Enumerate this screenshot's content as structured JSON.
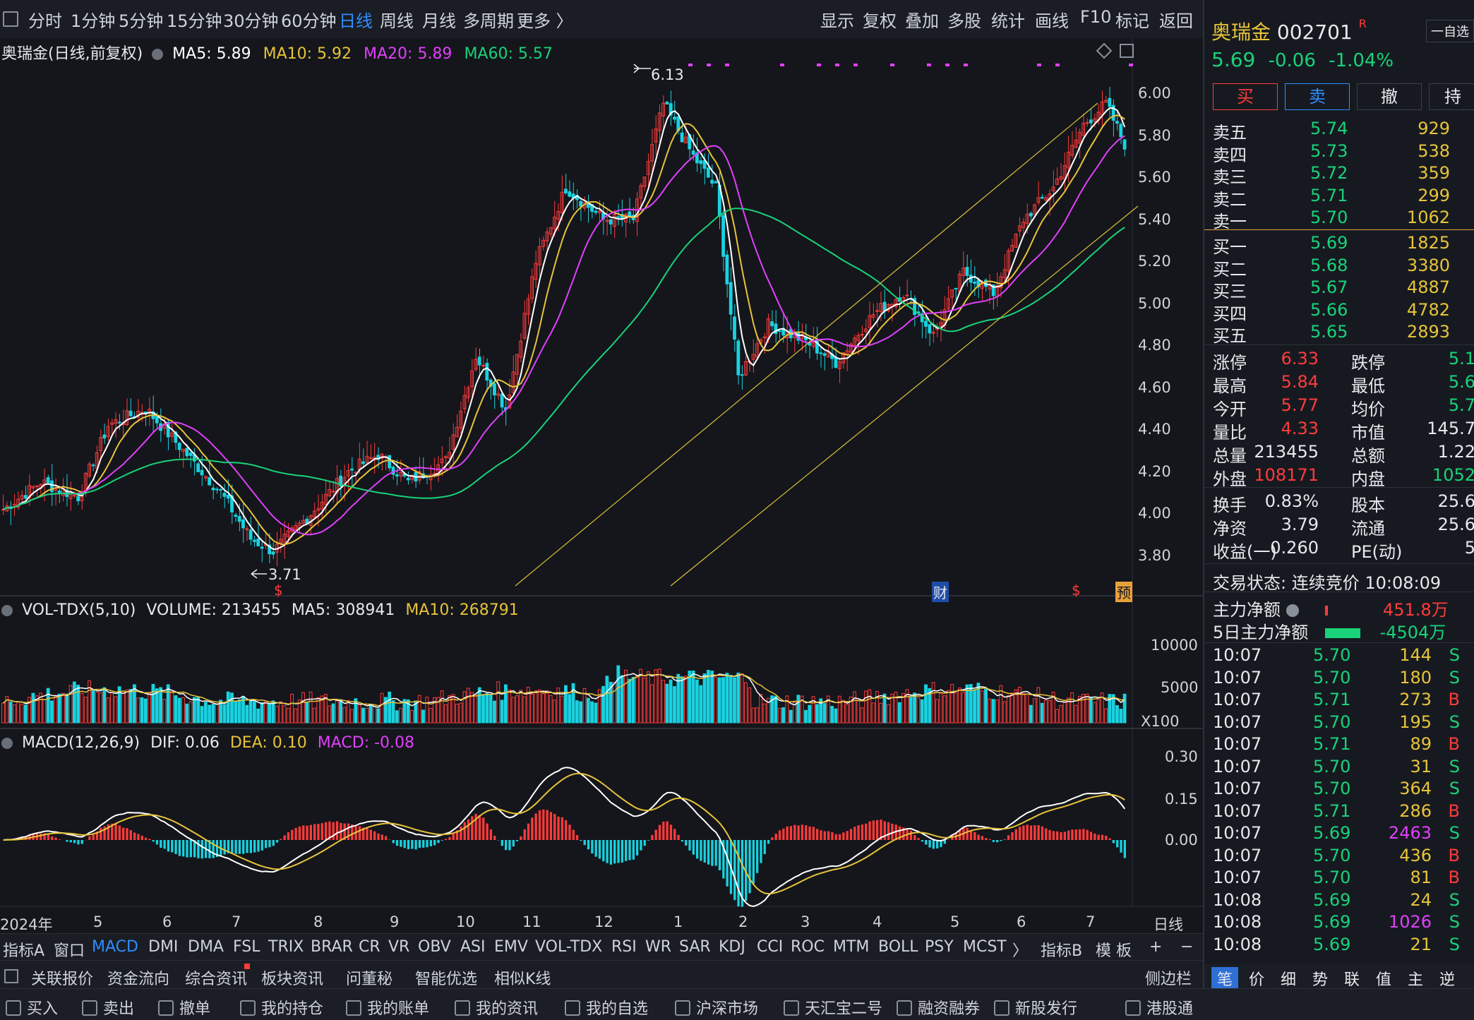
{
  "toolbar": {
    "periods": [
      "分时",
      "1分钟",
      "5分钟",
      "15分钟",
      "30分钟",
      "60分钟",
      "日线",
      "周线",
      "月线",
      "多周期",
      "更多 〉"
    ],
    "active_period": "日线",
    "right_tools": [
      "显示",
      "复权",
      "叠加",
      "多股",
      "统计",
      "画线",
      "F10",
      "标记",
      "返回"
    ]
  },
  "main": {
    "legend_title": "奥瑞金(日线,前复权)",
    "ma": [
      {
        "label": "MA5: 5.89",
        "color": "#ffffff"
      },
      {
        "label": "MA10: 5.92",
        "color": "#e8c33a"
      },
      {
        "label": "MA20: 5.89",
        "color": "#e040fb"
      },
      {
        "label": "MA60: 5.57",
        "color": "#19d27a"
      }
    ],
    "price_ticks": [
      "6.00",
      "5.80",
      "5.60",
      "5.40",
      "5.20",
      "5.00",
      "4.80",
      "4.60",
      "4.40",
      "4.20",
      "4.00",
      "3.80"
    ],
    "high_label": "6.13",
    "low_label": "3.71",
    "markers": {
      "cai": "财",
      "s": "$",
      "yu": "预"
    }
  },
  "volume": {
    "legend_title": "VOL-TDX(5,10)",
    "volume_label": "VOLUME: 213455",
    "ma5_label": "MA5: 308941",
    "ma10_label": "MA10: 268791",
    "ticks": [
      "10000",
      "5000"
    ],
    "unit": "X100"
  },
  "macd": {
    "legend_title": "MACD(12,26,9)",
    "dif_label": "DIF: 0.06",
    "dea_label": "DEA: 0.10",
    "macd_label": "MACD: -0.08",
    "ticks": [
      "0.30",
      "0.15",
      "0.00"
    ]
  },
  "xaxis": {
    "labels": [
      "2024年",
      "5",
      "6",
      "7",
      "8",
      "9",
      "10",
      "11",
      "12",
      "1",
      "2",
      "3",
      "4",
      "5",
      "6",
      "7"
    ],
    "right": "日线"
  },
  "indicator_tabs": [
    "指标A",
    "窗口",
    "MACD",
    "DMI",
    "DMA",
    "FSL",
    "TRIX",
    "BRAR",
    "CR",
    "VR",
    "OBV",
    "ASI",
    "EMV",
    "VOL-TDX",
    "RSI",
    "WR",
    "SAR",
    "KDJ",
    "CCI",
    "ROC",
    "MTM",
    "BOLL",
    "PSY",
    "MCST",
    "〉",
    "指标B",
    "模 板",
    "+",
    "−"
  ],
  "indicator_active": "MACD",
  "info_tabs": [
    "关联报价",
    "资金流向",
    "综合资讯",
    "板块资讯",
    "问董秘",
    "智能优选",
    "相似K线"
  ],
  "sidebar_toggle": "侧边栏",
  "quote": {
    "name": "奥瑞金",
    "code": "002701",
    "badge": "R",
    "add_watch": "一自选",
    "price": "5.69",
    "change": "-0.06",
    "change_pct": "-1.04%",
    "buttons": [
      "买",
      "卖",
      "撤",
      "持"
    ],
    "sell": [
      {
        "label": "卖五",
        "price": "5.74",
        "vol": "929"
      },
      {
        "label": "卖四",
        "price": "5.73",
        "vol": "538"
      },
      {
        "label": "卖三",
        "price": "5.72",
        "vol": "359"
      },
      {
        "label": "卖二",
        "price": "5.71",
        "vol": "299"
      },
      {
        "label": "卖一",
        "price": "5.70",
        "vol": "1062"
      }
    ],
    "buy": [
      {
        "label": "买一",
        "price": "5.69",
        "vol": "1825"
      },
      {
        "label": "买二",
        "price": "5.68",
        "vol": "3380"
      },
      {
        "label": "买三",
        "price": "5.67",
        "vol": "4887"
      },
      {
        "label": "买四",
        "price": "5.66",
        "vol": "4782"
      },
      {
        "label": "买五",
        "price": "5.65",
        "vol": "2893"
      }
    ],
    "stats": [
      {
        "l": "涨停",
        "v": "6.33",
        "vc": "#ff3b3b",
        "l2": "跌停",
        "v2": "5.1",
        "v2c": "#19d27a"
      },
      {
        "l": "最高",
        "v": "5.84",
        "vc": "#ff3b3b",
        "l2": "最低",
        "v2": "5.6",
        "v2c": "#19d27a"
      },
      {
        "l": "今开",
        "v": "5.77",
        "vc": "#ff3b3b",
        "l2": "均价",
        "v2": "5.7",
        "v2c": "#19d27a"
      },
      {
        "l": "量比",
        "v": "4.33",
        "vc": "#ff3b3b",
        "l2": "市值",
        "v2": "145.7",
        "v2c": "#e6e9ee"
      },
      {
        "l": "总量",
        "v": "213455",
        "vc": "#e6e9ee",
        "l2": "总额",
        "v2": "1.22",
        "v2c": "#e6e9ee"
      },
      {
        "l": "外盘",
        "v": "108171",
        "vc": "#ff3b3b",
        "l2": "内盘",
        "v2": "1052",
        "v2c": "#19d27a"
      },
      {
        "l": "换手",
        "v": "0.83%",
        "vc": "#e6e9ee",
        "l2": "股本",
        "v2": "25.6",
        "v2c": "#e6e9ee"
      },
      {
        "l": "净资",
        "v": "3.79",
        "vc": "#e6e9ee",
        "l2": "流通",
        "v2": "25.6",
        "v2c": "#e6e9ee"
      },
      {
        "l": "收益(一)",
        "v": "0.260",
        "vc": "#e6e9ee",
        "l2": "PE(动)",
        "v2": "5",
        "v2c": "#e6e9ee"
      }
    ],
    "trade_status": "交易状态: 连续竞价 10:08:09",
    "main_net_label": "主力净额",
    "main_net_value": "451.8万",
    "main_net_5d_label": "5日主力净额",
    "main_net_5d_value": "-4504万",
    "ticks": [
      {
        "t": "10:07",
        "p": "5.70",
        "v": "144",
        "d": "S"
      },
      {
        "t": "10:07",
        "p": "5.70",
        "v": "180",
        "d": "S"
      },
      {
        "t": "10:07",
        "p": "5.71",
        "v": "273",
        "d": "B"
      },
      {
        "t": "10:07",
        "p": "5.70",
        "v": "195",
        "d": "S"
      },
      {
        "t": "10:07",
        "p": "5.71",
        "v": "89",
        "d": "B"
      },
      {
        "t": "10:07",
        "p": "5.70",
        "v": "31",
        "d": "S"
      },
      {
        "t": "10:07",
        "p": "5.70",
        "v": "364",
        "d": "S"
      },
      {
        "t": "10:07",
        "p": "5.71",
        "v": "286",
        "d": "B"
      },
      {
        "t": "10:07",
        "p": "5.69",
        "v": "2463",
        "d": "S"
      },
      {
        "t": "10:07",
        "p": "5.70",
        "v": "436",
        "d": "B"
      },
      {
        "t": "10:07",
        "p": "5.70",
        "v": "81",
        "d": "B"
      },
      {
        "t": "10:08",
        "p": "5.69",
        "v": "24",
        "d": "S"
      },
      {
        "t": "10:08",
        "p": "5.69",
        "v": "1026",
        "d": "S"
      },
      {
        "t": "10:08",
        "p": "5.69",
        "v": "21",
        "d": "S"
      }
    ],
    "bottom_tabs": [
      "笔",
      "价",
      "细",
      "势",
      "联",
      "值",
      "主",
      "逆"
    ]
  },
  "statusbar": [
    "买入",
    "卖出",
    "撤单",
    "我的持仓",
    "我的账单",
    "我的资讯",
    "我的自选",
    "沪深市场",
    "天汇宝二号",
    "融资融券",
    "新股发行",
    "港股通"
  ]
}
